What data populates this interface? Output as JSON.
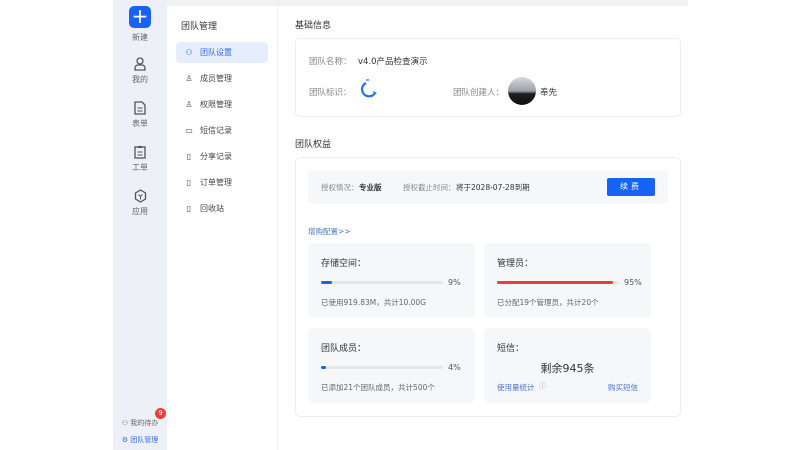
{
  "rail": {
    "new": "新建",
    "mine": "我的",
    "forms": "表单",
    "tickets": "工单",
    "apps": "应用",
    "todo": "我的待办",
    "todo_badge": "9",
    "team": "团队管理"
  },
  "submenu": {
    "title": "团队管理",
    "items": [
      {
        "label": "团队设置",
        "icon": "team-icon"
      },
      {
        "label": "成员管理",
        "icon": "member-icon"
      },
      {
        "label": "权限管理",
        "icon": "permission-icon"
      },
      {
        "label": "短信记录",
        "icon": "message-icon"
      },
      {
        "label": "分享记录",
        "icon": "share-file-icon"
      },
      {
        "label": "订单管理",
        "icon": "order-file-icon"
      },
      {
        "label": "回收站",
        "icon": "recycle-icon"
      }
    ]
  },
  "basic": {
    "title": "基础信息",
    "name_label": "团队名称：",
    "name": "v4.0产品检查演示",
    "logo_label": "团队标识：",
    "creator_label": "团队创建人：",
    "creator": "奉先"
  },
  "rights": {
    "title": "团队权益",
    "license_label": "授权情况：",
    "license": "专业版",
    "expire_label": "授权截止时间：",
    "expire": "将于2028-07-28到期",
    "renew": "续费",
    "buy_more": "增购配置>>",
    "storage": {
      "title": "存储空间：",
      "percent": 9,
      "pct_text": "9%",
      "desc": "已使用919.83M，共计10.00G",
      "color": "#1763f6"
    },
    "admins": {
      "title": "管理员：",
      "percent": 95,
      "pct_text": "95%",
      "desc": "已分配19个管理员，共计20个",
      "color": "#f03b3b"
    },
    "members": {
      "title": "团队成员：",
      "percent": 4,
      "pct_text": "4%",
      "desc": "已添加21个团队成员，共计500个",
      "color": "#1763f6"
    },
    "sms": {
      "title": "短信：",
      "remaining": "剩余945条",
      "stats": "使用量统计",
      "buy": "购买短信"
    }
  }
}
